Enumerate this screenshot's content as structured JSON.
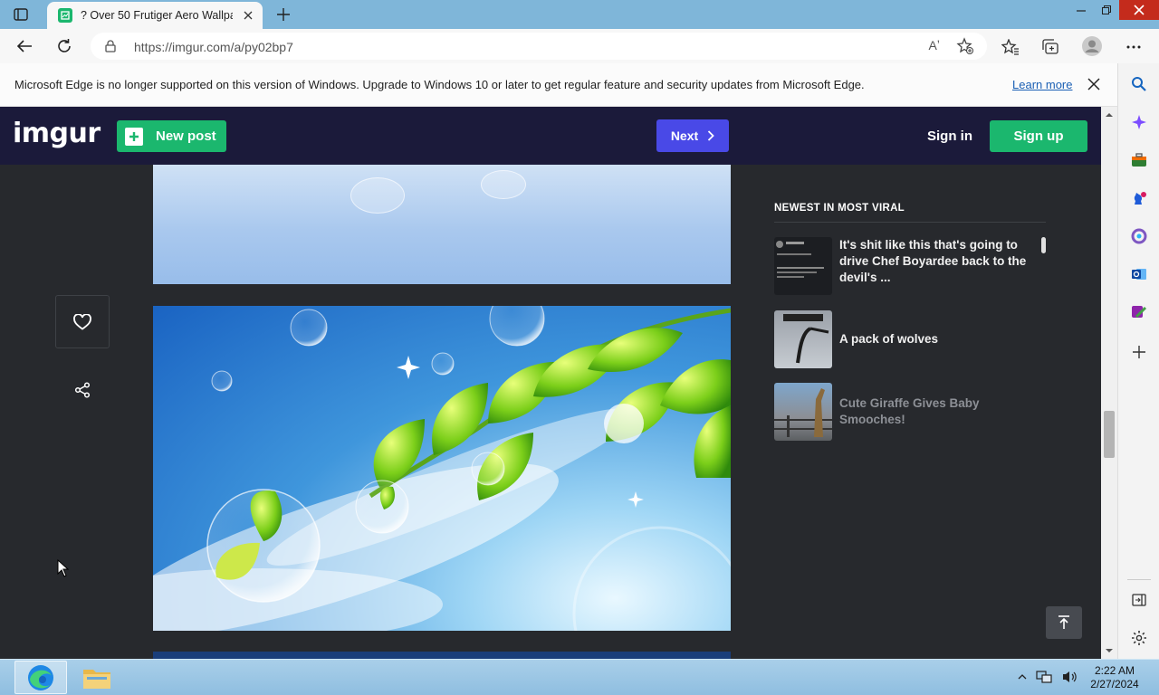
{
  "browser": {
    "tab": {
      "title": "? Over 50 Frutiger Aero Wallpapers"
    },
    "address": {
      "url": "https://imgur.com/a/py02bp7",
      "read_aloud": "Aʼ"
    },
    "infobar": {
      "message": "Microsoft Edge is no longer supported on this version of Windows. Upgrade to Windows 10 or later to get regular feature and security updates from Microsoft Edge.",
      "link": "Learn more"
    }
  },
  "imgur": {
    "logo": "imgur",
    "new_post": "New post",
    "next": "Next",
    "sign_in": "Sign in",
    "sign_up": "Sign up",
    "sidebar": {
      "heading": "NEWEST IN MOST VIRAL",
      "items": [
        {
          "title": "It's shit like this that's going to drive Chef Boyardee back to the devil's ...",
          "thumb": "tweet-screenshot"
        },
        {
          "title": "A pack of wolves",
          "thumb": "snow-wolves"
        },
        {
          "title": "Cute Giraffe Gives Baby Smooches!",
          "thumb": "giraffe"
        }
      ]
    }
  },
  "taskbar": {
    "time": "2:22 AM",
    "date": "2/27/2024"
  },
  "colors": {
    "imgur_green": "#1bb76e",
    "imgur_header": "#1b1a3a",
    "next_blue": "#4949e7",
    "page_bg": "#27292d"
  }
}
